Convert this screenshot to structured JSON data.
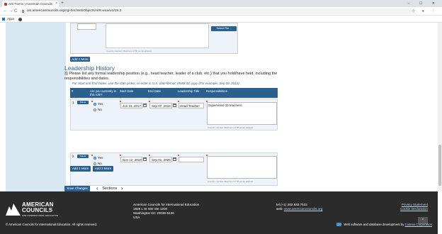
{
  "browser": {
    "tab_title": "AIS Forms | American Councils",
    "tab_close": "×",
    "new_tab": "+",
    "window_controls": "– ☐ ✕",
    "url": "ais.americancouncils.org/cgi-bin/WebObjects/AIR.woa/wo/19.3",
    "bookmarks_apps": "Apps",
    "nav_back": "←",
    "nav_forward": "→",
    "nav_reload": "C"
  },
  "previous_section": {
    "word_count": "0 words counted. Maximum of 50 words allowed.",
    "select_file": "Select File...",
    "add_more": "Add 1 More"
  },
  "leadership": {
    "heading": "Leadership History",
    "question": "3)  Please list any formal leadership position (e.g., head teacher, leader of a club, etc.) that you hold/have held, including the responsibilities and dates.",
    "hint": "For Start and End Dates, use the date picker, or enter in U.S. date format: MMM dd, yyyy (For example, Sep 30, 2012).",
    "columns": [
      "#",
      "Are you currently in this role?",
      "Start Date",
      "End Date",
      "Leadership Title",
      "Responsibilities"
    ],
    "rows": [
      {
        "num": "1",
        "delete": "Delete",
        "yes": "Yes",
        "no": "No",
        "current": "yes",
        "start": "Jun 15, 2017",
        "end": "Sep 07, 2018",
        "title": "Head Teacher",
        "responsibilities": "Supervised 15 teachers",
        "word_count": "3 words counted. Maximum of 50 words allowed."
      },
      {
        "num": "2",
        "delete": "Delete",
        "yes": "Yes",
        "no": "No",
        "current": "yes",
        "start": "Nov 12, 2019",
        "end": "Sep 01, 2020",
        "title": "",
        "responsibilities": "",
        "word_count": "0 words counted. Maximum of 50 words allowed."
      }
    ],
    "add_1_more": "Add 1 More",
    "add_2_more": "Add 2 More"
  },
  "actions": {
    "save": "Save Changes",
    "sections": "Sections",
    "prev": "‹",
    "next": "›"
  },
  "footer": {
    "logo_line1": "AMERICAN",
    "logo_line2": "COUNCILS",
    "logo_line3": "FOR INTERNATIONAL EDUCATION",
    "org": "American Councils for International Education",
    "street": "1828 L St NW Ste 1200",
    "city": "Washington DC 20036-5136",
    "country": "USA",
    "tel": "tel (+1) 202.833.7522",
    "web_label": "web:",
    "web": "www.americancouncils.org",
    "privacy": "Privacy Statement",
    "cookie": "Cookie Declaration",
    "copyright": "© American Councils for International Education. All rights reserved.",
    "dev_text": "Web software and database development by",
    "dev_link": "Codeus Corporation",
    "to_top": "^"
  }
}
